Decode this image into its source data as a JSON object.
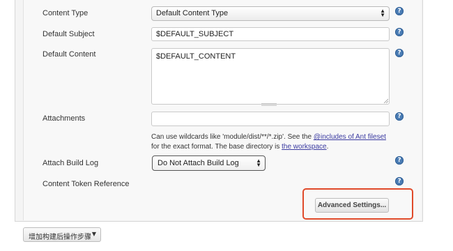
{
  "form": {
    "content_type": {
      "label": "Content Type",
      "value": "Default Content Type"
    },
    "default_subject": {
      "label": "Default Subject",
      "value": "$DEFAULT_SUBJECT"
    },
    "default_content": {
      "label": "Default Content",
      "value": "$DEFAULT_CONTENT"
    },
    "attachments": {
      "label": "Attachments",
      "value": "",
      "hint_prefix": "Can use wildcards like 'module/dist/**/*.zip'. See the ",
      "hint_link": "@includes of Ant fileset",
      "hint_middle": "for the exact format. The base directory is ",
      "hint_link2": "the workspace",
      "hint_suffix": "."
    },
    "attach_build_log": {
      "label": "Attach Build Log",
      "value": "Do Not Attach Build Log"
    },
    "content_token_reference": {
      "label": "Content Token Reference"
    },
    "advanced_button": "Advanced Settings...",
    "help_glyph": "?"
  },
  "footer": {
    "add_step_label": "增加构建后操作步骤"
  },
  "colors": {
    "help_icon": "#4a7cb4",
    "highlight_border": "#e04a2a",
    "panel_bg": "#f4f4f4"
  },
  "icons": {
    "help": "question-circle-icon",
    "select_arrows": "up-down-arrows-icon",
    "caret": "caret-down-icon"
  }
}
